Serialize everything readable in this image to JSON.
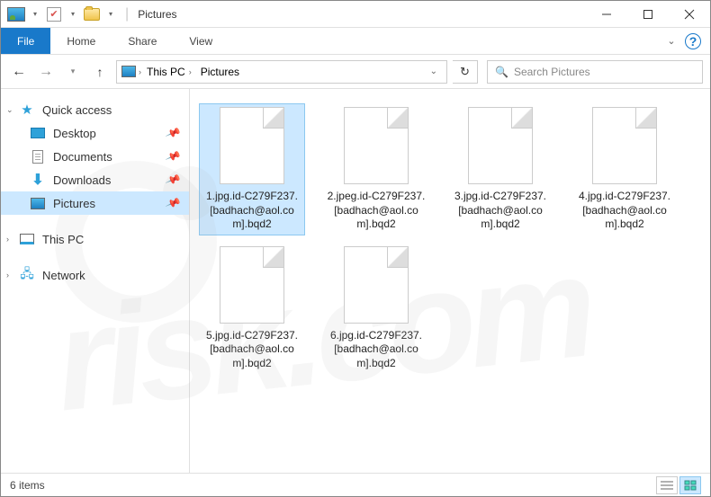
{
  "titlebar": {
    "title": "Pictures"
  },
  "ribbon": {
    "file": "File",
    "tabs": [
      "Home",
      "Share",
      "View"
    ]
  },
  "address": {
    "segments": [
      {
        "label": "This PC"
      },
      {
        "label": "Pictures"
      }
    ]
  },
  "search": {
    "placeholder": "Search Pictures"
  },
  "sidebar": {
    "quick_access": "Quick access",
    "items": [
      {
        "label": "Desktop",
        "pinned": true,
        "icon": "desktop"
      },
      {
        "label": "Documents",
        "pinned": true,
        "icon": "doc"
      },
      {
        "label": "Downloads",
        "pinned": true,
        "icon": "down"
      },
      {
        "label": "Pictures",
        "pinned": true,
        "icon": "pic",
        "selected": true
      }
    ],
    "this_pc": "This PC",
    "network": "Network"
  },
  "files": [
    {
      "name": "1.jpg.id-C279F237.[badhach@aol.com].bqd2",
      "selected": true
    },
    {
      "name": "2.jpeg.id-C279F237.[badhach@aol.com].bqd2"
    },
    {
      "name": "3.jpg.id-C279F237.[badhach@aol.com].bqd2"
    },
    {
      "name": "4.jpg.id-C279F237.[badhach@aol.com].bqd2"
    },
    {
      "name": "5.jpg.id-C279F237.[badhach@aol.com].bqd2"
    },
    {
      "name": "6.jpg.id-C279F237.[badhach@aol.com].bqd2"
    }
  ],
  "status": {
    "count": "6 items"
  }
}
